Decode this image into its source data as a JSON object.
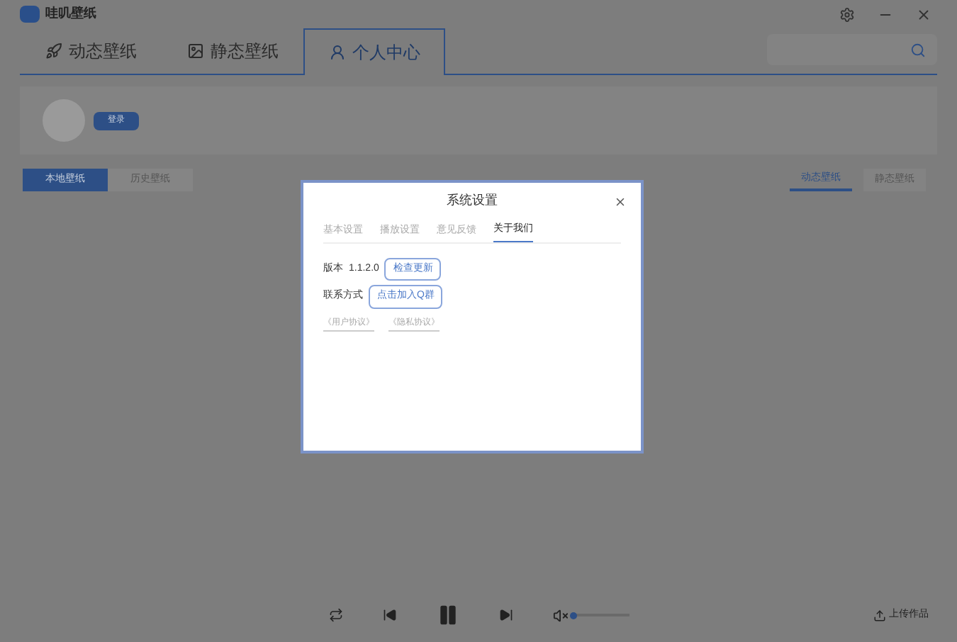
{
  "window": {
    "title": "哇叽壁纸"
  },
  "main_tabs": [
    {
      "label": "动态壁纸",
      "selected": false
    },
    {
      "label": "静态壁纸",
      "selected": false
    },
    {
      "label": "个人中心",
      "selected": true
    }
  ],
  "profile": {
    "login_button": "登录"
  },
  "left_tabs": [
    {
      "label": "本地壁纸",
      "selected": true
    },
    {
      "label": "历史壁纸",
      "selected": false
    }
  ],
  "right_tabs": [
    {
      "label": "动态壁纸",
      "selected": true
    },
    {
      "label": "静态壁纸",
      "selected": false
    }
  ],
  "dialog": {
    "title": "系统设置",
    "tabs": [
      {
        "label": "基本设置",
        "selected": false
      },
      {
        "label": "播放设置",
        "selected": false
      },
      {
        "label": "意见反馈",
        "selected": false
      },
      {
        "label": "关于我们",
        "selected": true
      }
    ],
    "version_label": "版本",
    "version": "1.1.2.0",
    "check_update_button": "检查更新",
    "contact_label": "联系方式",
    "join_group_button": "点击加入Q群",
    "links": [
      "《用户协议》",
      "《隐私协议》"
    ]
  },
  "player": {
    "muted": true,
    "volume": {
      "level": 0.02
    },
    "upload_button": "上传作品"
  }
}
